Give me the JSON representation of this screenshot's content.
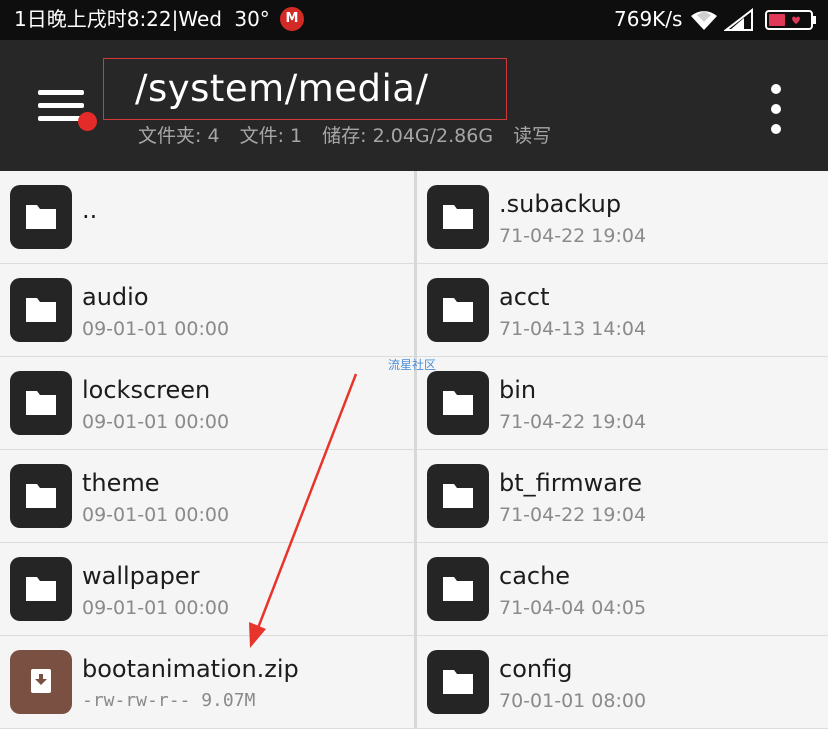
{
  "status_bar": {
    "left_text": "1日晚上戌时8:22|Wed",
    "temperature": "30°",
    "mega_badge": "M",
    "net_speed": "769K/s",
    "icons": [
      "mega-icon",
      "wifi-icon",
      "signal-icon",
      "battery-icon"
    ],
    "battery_color": "#e0395a"
  },
  "app_bar": {
    "path": "/system/media/",
    "folders": "文件夹: 4",
    "files": "文件: 1",
    "storage": "储存: 2.04G/2.86G",
    "mode": "读写",
    "icons": [
      "menu-icon",
      "more-vert-icon"
    ],
    "background": "#272727",
    "highlight_color": "#d23a3a"
  },
  "list": {
    "left": [
      {
        "name": "..",
        "meta": "",
        "type": "folder"
      },
      {
        "name": "audio",
        "meta": "09-01-01 00:00",
        "type": "folder"
      },
      {
        "name": "lockscreen",
        "meta": "09-01-01 00:00",
        "type": "folder"
      },
      {
        "name": "theme",
        "meta": "09-01-01 00:00",
        "type": "folder"
      },
      {
        "name": "wallpaper",
        "meta": "09-01-01 00:00",
        "type": "folder"
      },
      {
        "name": "bootanimation.zip",
        "meta": "-rw-rw-r--  9.07M",
        "type": "archive"
      }
    ],
    "right": [
      {
        "name": ".subackup",
        "meta": "71-04-22 19:04",
        "type": "folder"
      },
      {
        "name": "acct",
        "meta": "71-04-13 14:04",
        "type": "folder"
      },
      {
        "name": "bin",
        "meta": "71-04-22 19:04",
        "type": "folder"
      },
      {
        "name": "bt_firmware",
        "meta": "71-04-22 19:04",
        "type": "folder"
      },
      {
        "name": "cache",
        "meta": "71-04-04 04:05",
        "type": "folder"
      },
      {
        "name": "config",
        "meta": "70-01-01 08:00",
        "type": "folder"
      }
    ],
    "folder_icon_color": "#252525",
    "archive_icon_color": "#7a5043"
  },
  "watermark": "流星社区",
  "annotation_arrow_color": "#e8352c"
}
